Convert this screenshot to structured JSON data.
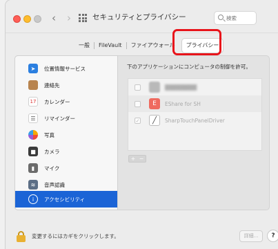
{
  "window": {
    "title": "セキュリティとプライバシー"
  },
  "toolbar": {
    "back_glyph": "‹",
    "forward_glyph": "›",
    "grid_icon": "grid-icon"
  },
  "search": {
    "placeholder": "検索"
  },
  "tabs": [
    {
      "label": "一般",
      "active": false
    },
    {
      "label": "FileVault",
      "active": false
    },
    {
      "label": "ファイアウォール",
      "active": false
    },
    {
      "label": "プライバシー",
      "active": true
    }
  ],
  "highlight_color": "#e8141b",
  "sidebar": {
    "items": [
      {
        "label": "位置情報サービス",
        "icon": "location-arrow-icon",
        "glyph": "➤"
      },
      {
        "label": "連絡先",
        "icon": "contacts-book-icon",
        "glyph": ""
      },
      {
        "label": "カレンダー",
        "icon": "calendar-icon",
        "glyph": "17"
      },
      {
        "label": "リマインダー",
        "icon": "reminders-list-icon",
        "glyph": "☰"
      },
      {
        "label": "写真",
        "icon": "photos-flower-icon",
        "glyph": ""
      },
      {
        "label": "カメラ",
        "icon": "camera-icon",
        "glyph": "■"
      },
      {
        "label": "マイク",
        "icon": "microphone-icon",
        "glyph": "▮"
      },
      {
        "label": "音声認識",
        "icon": "speech-waveform-icon",
        "glyph": "≋"
      },
      {
        "label": "アクセシビリティ",
        "icon": "accessibility-icon",
        "glyph": "i",
        "selected": true
      }
    ]
  },
  "content": {
    "heading": "下のアプリケーションにコンピュータの制御を許可。",
    "apps": [
      {
        "name": "████████",
        "checked": false,
        "icon": "blurred-app-icon",
        "blurred": true
      },
      {
        "name": "EShare for SH",
        "checked": false,
        "icon": "eshare-app-icon",
        "glyph": "E"
      },
      {
        "name": "SharpTouchPanelDriver",
        "checked": true,
        "icon": "sharp-touch-icon",
        "glyph": "╱"
      }
    ],
    "add_glyph": "+",
    "remove_glyph": "−"
  },
  "footer": {
    "lock_text": "変更するにはカギをクリックします。",
    "advanced_label": "詳細...",
    "help_label": "?"
  }
}
